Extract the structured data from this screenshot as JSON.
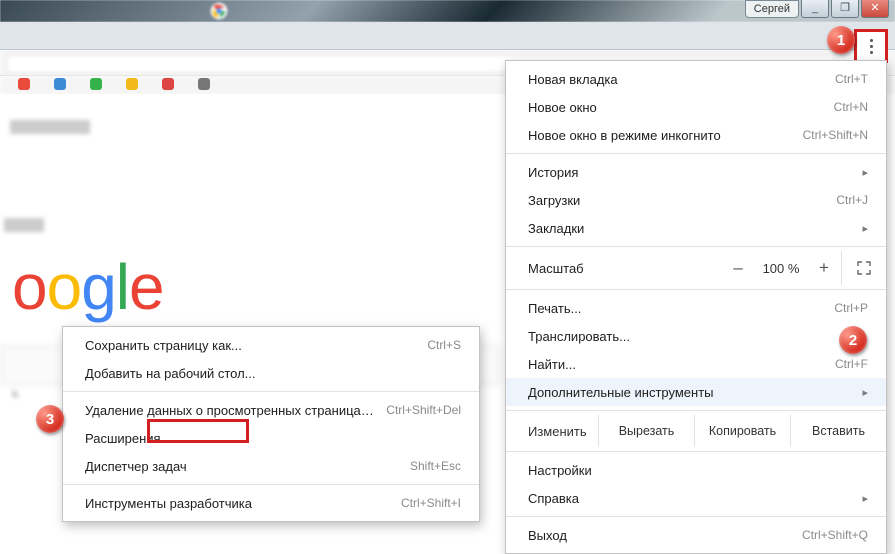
{
  "window": {
    "username": "Сергей",
    "minimize": "_",
    "maximize": "❐",
    "close": "✕"
  },
  "badges": {
    "b1": "1",
    "b2": "2",
    "b3": "3"
  },
  "menu": {
    "new_tab": {
      "label": "Новая вкладка",
      "shortcut": "Ctrl+T"
    },
    "new_window": {
      "label": "Новое окно",
      "shortcut": "Ctrl+N"
    },
    "incognito": {
      "label": "Новое окно в режиме инкогнито",
      "shortcut": "Ctrl+Shift+N"
    },
    "history": {
      "label": "История",
      "arrow": "▸"
    },
    "downloads": {
      "label": "Загрузки",
      "shortcut": "Ctrl+J"
    },
    "bookmarks": {
      "label": "Закладки",
      "arrow": "▸"
    },
    "zoom": {
      "label": "Масштаб",
      "minus": "–",
      "value": "100 %",
      "plus": "+"
    },
    "print": {
      "label": "Печать...",
      "shortcut": "Ctrl+P"
    },
    "cast": {
      "label": "Транслировать..."
    },
    "find": {
      "label": "Найти...",
      "shortcut": "Ctrl+F"
    },
    "more_tools": {
      "label": "Дополнительные инструменты",
      "arrow": "▸"
    },
    "edit": {
      "label": "Изменить",
      "cut": "Вырезать",
      "copy": "Копировать",
      "paste": "Вставить"
    },
    "settings": {
      "label": "Настройки"
    },
    "help": {
      "label": "Справка",
      "arrow": "▸"
    },
    "exit": {
      "label": "Выход",
      "shortcut": "Ctrl+Shift+Q"
    }
  },
  "submenu": {
    "save_page": {
      "label": "Сохранить страницу как...",
      "shortcut": "Ctrl+S"
    },
    "add_desktop": {
      "label": "Добавить на рабочий стол..."
    },
    "clear_data": {
      "label": "Удаление данных о просмотренных страницах...",
      "shortcut": "Ctrl+Shift+Del"
    },
    "extensions": {
      "label": "Расширения"
    },
    "task_mgr": {
      "label": "Диспетчер задач",
      "shortcut": "Shift+Esc"
    },
    "dev_tools": {
      "label": "Инструменты разработчика",
      "shortcut": "Ctrl+Shift+I"
    }
  },
  "google_logo": {
    "o1": "o",
    "o2": "o",
    "g": "g",
    "l": "l",
    "e": "e"
  }
}
